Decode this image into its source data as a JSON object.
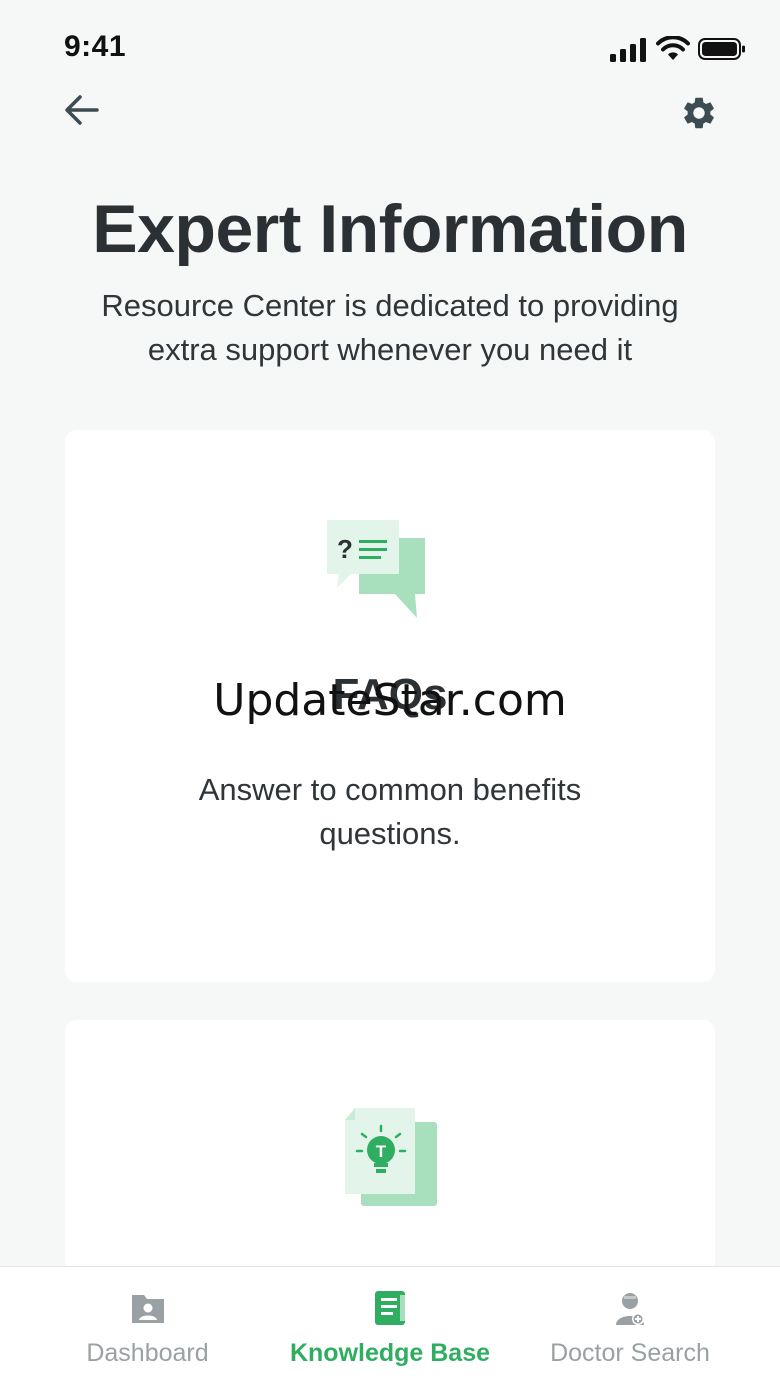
{
  "status": {
    "time": "9:41"
  },
  "header": {
    "title": "Expert Information",
    "subtitle_line1": "Resource Center is dedicated to providing",
    "subtitle_line2": "extra support whenever you need it",
    "back_icon": "arrow-left-icon",
    "settings_icon": "gear-icon"
  },
  "cards": [
    {
      "title": "FAQs",
      "desc_line1": "Answer to common benefits",
      "desc_line2": "questions.",
      "icon": "faq-chat-icon"
    },
    {
      "icon": "lightbulb-document-icon"
    }
  ],
  "watermark": "UpdateStar.com",
  "tabs": [
    {
      "label": "Dashboard",
      "icon": "folder-user-icon",
      "active": false
    },
    {
      "label": "Knowledge Base",
      "icon": "book-icon",
      "active": true
    },
    {
      "label": "Doctor Search",
      "icon": "doctor-icon",
      "active": false
    }
  ],
  "colors": {
    "accent": "#2fae62",
    "accent_light": "#a8dfbc",
    "accent_pale": "#e3f5ea",
    "text": "#2a3033",
    "muted": "#9aa1a4",
    "background": "#f6f7f7"
  }
}
